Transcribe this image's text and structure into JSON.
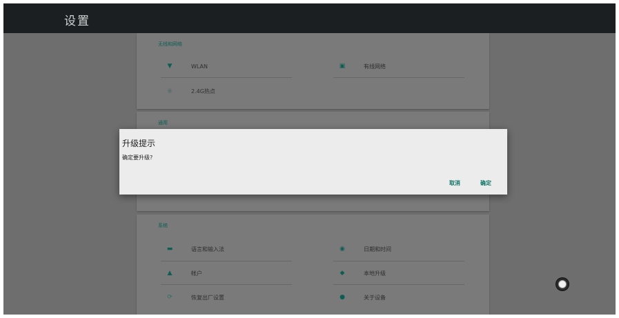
{
  "appbar": {
    "title": "设置"
  },
  "wireless": {
    "header": "无线和网络",
    "items": [
      {
        "label": "WLAN",
        "icon": "wifi-icon"
      },
      {
        "label": "有线网络",
        "icon": "ethernet-icon"
      },
      {
        "label": "2.4G热点",
        "icon": "hotspot-icon"
      }
    ]
  },
  "general": {
    "header": "通用"
  },
  "system": {
    "header": "系统",
    "items": [
      {
        "label": "语言和输入法",
        "icon": "keyboard-icon"
      },
      {
        "label": "日期和时间",
        "icon": "clock-icon"
      },
      {
        "label": "帐户",
        "icon": "account-icon"
      },
      {
        "label": "本地升级",
        "icon": "upgrade-icon"
      },
      {
        "label": "恢复出厂设置",
        "icon": "restore-icon"
      },
      {
        "label": "关于设备",
        "icon": "info-icon"
      }
    ]
  },
  "dialog": {
    "title": "升级提示",
    "message": "确定要升级?",
    "cancel_label": "取消",
    "confirm_label": "确定"
  },
  "colors": {
    "accent": "#0f7466",
    "appbar": "#1c1f21",
    "dim_background": "#6e6e6e"
  }
}
